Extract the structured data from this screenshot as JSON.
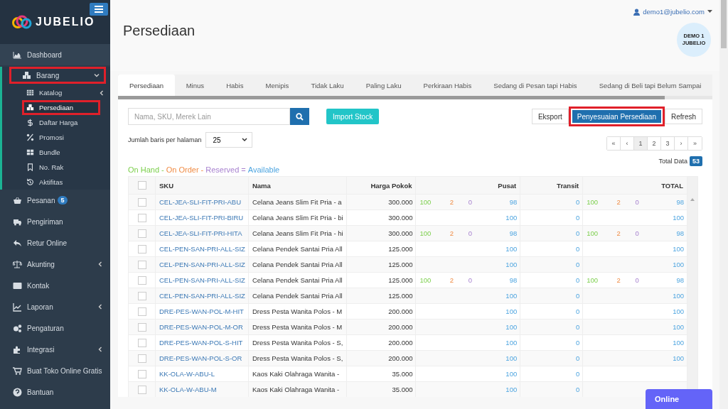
{
  "brand": {
    "name": "JUBELIO"
  },
  "sidebar": {
    "items": [
      {
        "label": "Dashboard",
        "selected": false
      },
      {
        "label": "Barang",
        "selected": false,
        "expanded": true,
        "highlighted": true,
        "children": [
          {
            "label": "Katalog",
            "selected": false,
            "has_submenu": true
          },
          {
            "label": "Persediaan",
            "selected": true,
            "highlighted": true
          },
          {
            "label": "Daftar Harga",
            "selected": false
          },
          {
            "label": "Promosi",
            "selected": false
          },
          {
            "label": "Bundle",
            "selected": false
          },
          {
            "label": "No. Rak",
            "selected": false
          },
          {
            "label": "Aktifitas",
            "selected": false
          }
        ]
      },
      {
        "label": "Pesanan",
        "selected": false,
        "badge": "5"
      },
      {
        "label": "Pengiriman",
        "selected": false
      },
      {
        "label": "Retur Online",
        "selected": false
      },
      {
        "label": "Akunting",
        "selected": false,
        "has_submenu": true
      },
      {
        "label": "Kontak",
        "selected": false
      },
      {
        "label": "Laporan",
        "selected": false,
        "has_submenu": true
      },
      {
        "label": "Pengaturan",
        "selected": false
      },
      {
        "label": "Integrasi",
        "selected": false,
        "has_submenu": true
      },
      {
        "label": "Buat Toko Online Gratis",
        "selected": false
      },
      {
        "label": "Bantuan",
        "selected": false
      }
    ]
  },
  "header": {
    "title": "Persediaan",
    "user": "demo1@jubelio.com",
    "avatar": "DEMO 1 JUBELIO"
  },
  "tabs": [
    {
      "label": "Persediaan",
      "selected": true
    },
    {
      "label": "Minus",
      "selected": false
    },
    {
      "label": "Habis",
      "selected": false
    },
    {
      "label": "Menipis",
      "selected": false
    },
    {
      "label": "Tidak Laku",
      "selected": false
    },
    {
      "label": "Paling Laku",
      "selected": false
    },
    {
      "label": "Perkiraan Habis",
      "selected": false
    },
    {
      "label": "Sedang di Pesan tapi Habis",
      "selected": false
    },
    {
      "label": "Sedang di Beli tapi Belum Sampai",
      "selected": false
    }
  ],
  "search": {
    "placeholder": "Nama, SKU, Merek Lain"
  },
  "buttons": {
    "import": "Import Stock",
    "export": "Eksport",
    "adjust": {
      "label": "Penyesuaian Persediaan",
      "highlighted": true
    },
    "refresh": "Refresh"
  },
  "page_size": {
    "label": "Jumlah baris per halaman",
    "value": "25"
  },
  "pagination": [
    {
      "label": "«",
      "selected": false
    },
    {
      "label": "‹",
      "selected": false
    },
    {
      "label": "1",
      "selected": true
    },
    {
      "label": "2",
      "selected": false
    },
    {
      "label": "3",
      "selected": false
    },
    {
      "label": "›",
      "selected": false
    },
    {
      "label": "»",
      "selected": false
    }
  ],
  "total": {
    "label": "Total Data",
    "count": "53"
  },
  "legend": [
    {
      "label": "On Hand",
      "operator": "-",
      "color": "#7ccf4c"
    },
    {
      "label": "On Order",
      "operator": "-",
      "color": "#f08c45"
    },
    {
      "label": "Reserved",
      "operator": "=",
      "color": "#a781cf"
    },
    {
      "label": "Available",
      "color": "#4ea5e0"
    }
  ],
  "table": {
    "header_checked": false,
    "columns": [
      "SKU",
      "Nama",
      "Harga Pokok",
      "Pusat",
      "Transit",
      "TOTAL"
    ],
    "rows": [
      {
        "checked": false,
        "sku": "CEL-JEA-SLI-FIT-PRI-ABU",
        "name": "Celana Jeans Slim Fit Pria - a",
        "price": "300.000",
        "pusat": {
          "on_hand": "100",
          "on_order": "2",
          "reserved": "0",
          "available": "98"
        },
        "transit": "0",
        "total": {
          "on_hand": "100",
          "on_order": "2",
          "reserved": "0",
          "available": "98"
        }
      },
      {
        "checked": false,
        "sku": "CEL-JEA-SLI-FIT-PRI-BIRU",
        "name": "Celana Jeans Slim Fit Pria - bi",
        "price": "300.000",
        "pusat": {
          "available": "100"
        },
        "transit": "0",
        "total": {
          "available": "100"
        }
      },
      {
        "checked": false,
        "sku": "CEL-JEA-SLI-FIT-PRI-HITA",
        "name": "Celana Jeans Slim Fit Pria - hi",
        "price": "300.000",
        "pusat": {
          "on_hand": "100",
          "on_order": "2",
          "reserved": "0",
          "available": "98"
        },
        "transit": "0",
        "total": {
          "on_hand": "100",
          "on_order": "2",
          "reserved": "0",
          "available": "98"
        }
      },
      {
        "checked": false,
        "sku": "CEL-PEN-SAN-PRI-ALL-SIZ",
        "name": "Celana Pendek Santai Pria All",
        "price": "125.000",
        "pusat": {
          "available": "100"
        },
        "transit": "0",
        "total": {
          "available": "100"
        }
      },
      {
        "checked": false,
        "sku": "CEL-PEN-SAN-PRI-ALL-SIZ",
        "name": "Celana Pendek Santai Pria All",
        "price": "125.000",
        "pusat": {
          "available": "100"
        },
        "transit": "0",
        "total": {
          "available": "100"
        }
      },
      {
        "checked": false,
        "sku": "CEL-PEN-SAN-PRI-ALL-SIZ",
        "name": "Celana Pendek Santai Pria All",
        "price": "125.000",
        "pusat": {
          "on_hand": "100",
          "on_order": "2",
          "reserved": "0",
          "available": "98"
        },
        "transit": "0",
        "total": {
          "on_hand": "100",
          "on_order": "2",
          "reserved": "0",
          "available": "98"
        }
      },
      {
        "checked": false,
        "sku": "CEL-PEN-SAN-PRI-ALL-SIZ",
        "name": "Celana Pendek Santai Pria All",
        "price": "125.000",
        "pusat": {
          "available": "100"
        },
        "transit": "0",
        "total": {
          "available": "100"
        }
      },
      {
        "checked": false,
        "sku": "DRE-PES-WAN-POL-M-HIT",
        "name": "Dress Pesta Wanita Polos - M",
        "price": "200.000",
        "pusat": {
          "available": "100"
        },
        "transit": "0",
        "total": {
          "available": "100"
        }
      },
      {
        "checked": false,
        "sku": "DRE-PES-WAN-POL-M-OR",
        "name": "Dress Pesta Wanita Polos - M",
        "price": "200.000",
        "pusat": {
          "available": "100"
        },
        "transit": "0",
        "total": {
          "available": "100"
        }
      },
      {
        "checked": false,
        "sku": "DRE-PES-WAN-POL-S-HIT",
        "name": "Dress Pesta Wanita Polos - S,",
        "price": "200.000",
        "pusat": {
          "available": "100"
        },
        "transit": "0",
        "total": {
          "available": "100"
        }
      },
      {
        "checked": false,
        "sku": "DRE-PES-WAN-POL-S-OR",
        "name": "Dress Pesta Wanita Polos - S,",
        "price": "200.000",
        "pusat": {
          "available": "100"
        },
        "transit": "0",
        "total": {
          "available": "100"
        }
      },
      {
        "checked": false,
        "sku": "KK-OLA-W-ABU-L",
        "name": "Kaos Kaki Olahraga Wanita -",
        "price": "35.000",
        "pusat": {
          "available": "100"
        },
        "transit": "0"
      },
      {
        "checked": false,
        "sku": "KK-OLA-W-ABU-M",
        "name": "Kaos Kaki Olahraga Wanita -",
        "price": "35.000",
        "pusat": {
          "available": "100"
        },
        "transit": "0"
      }
    ]
  },
  "chat": {
    "label": "Online"
  }
}
